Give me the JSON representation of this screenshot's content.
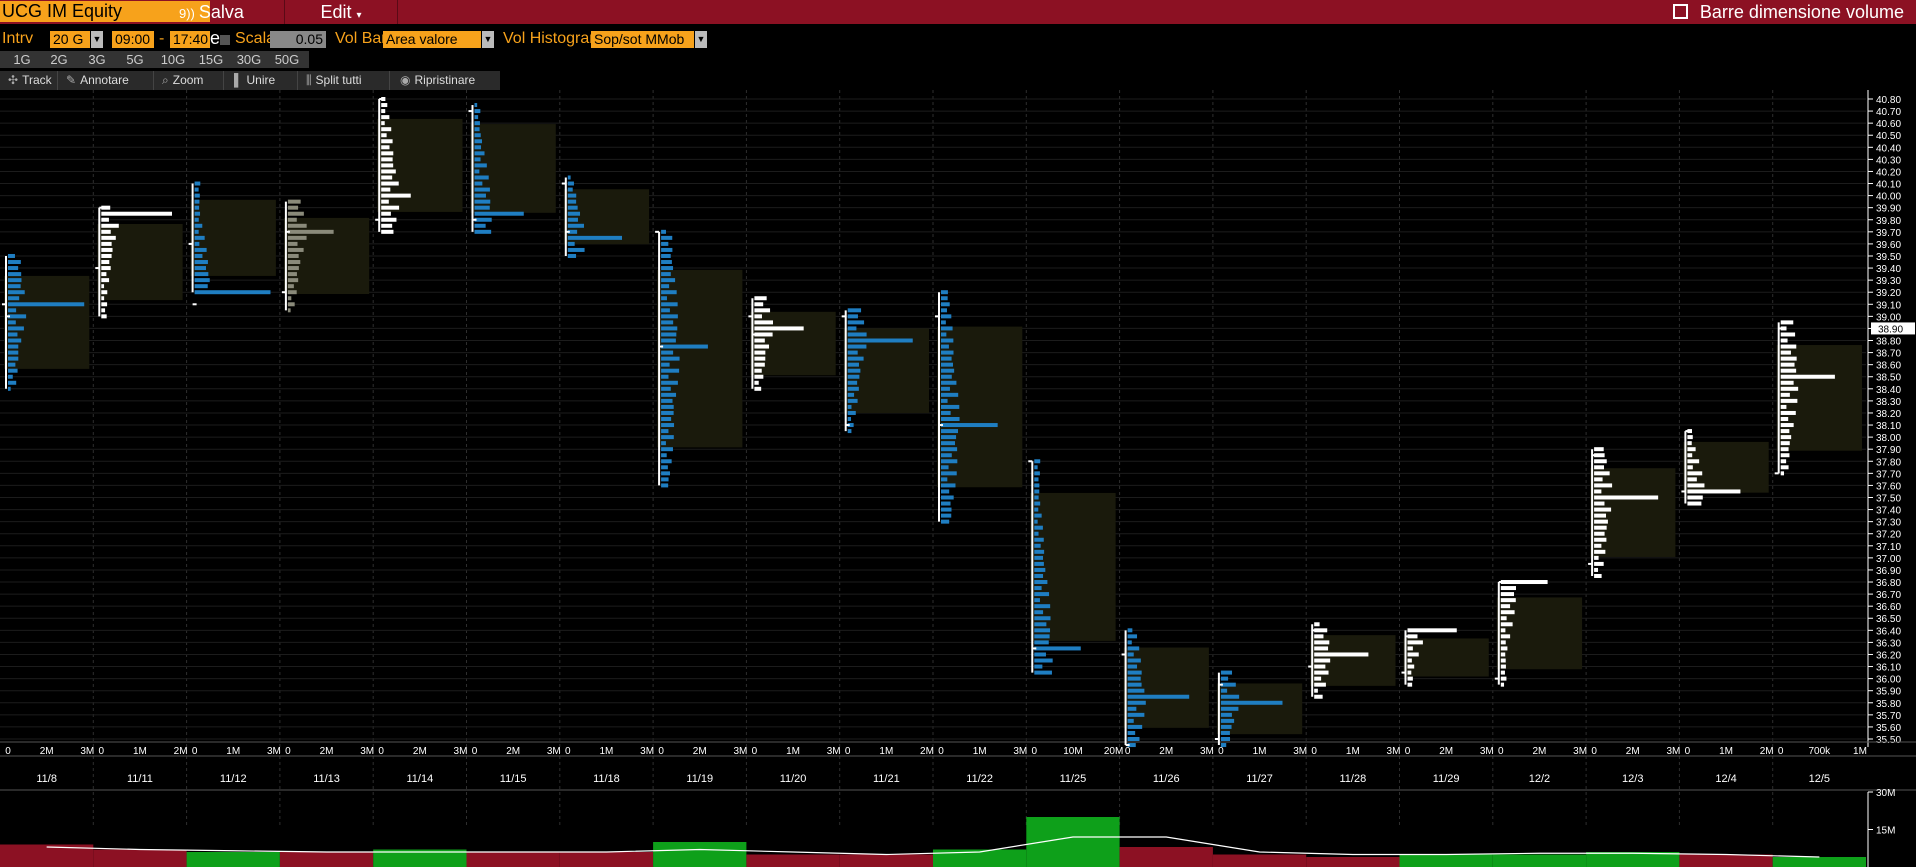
{
  "toolbar": {
    "ticker": "UCG IM Equity",
    "save_label": "Salva come",
    "edit_label": "Edit",
    "right_label": "Barre dimensione volume"
  },
  "settings": {
    "intrv_label": "Intrv",
    "intrv_value": "20 G",
    "start_time": "09:00",
    "dash": "-",
    "end_time": "17:40",
    "scala_label": "Scala",
    "scala_value": "0.05",
    "volbar_label": "Vol Bar",
    "volbar_value": "Area valore",
    "volhist_label": "Vol Histogram",
    "volhist_value": "Sop/sot MMob"
  },
  "periods": [
    "1G",
    "2G",
    "3G",
    "5G",
    "10G",
    "15G",
    "30G",
    "50G"
  ],
  "tools": [
    "Track",
    "Annotare",
    "Zoom",
    "Unire",
    "Split tutti",
    "Ripristinare"
  ],
  "chart_data": {
    "type": "bar",
    "title": "",
    "price_axis": {
      "ticks": [
        "40.80",
        "40.70",
        "40.60",
        "40.50",
        "40.40",
        "40.30",
        "40.20",
        "40.10",
        "40.00",
        "39.90",
        "39.80",
        "39.70",
        "39.60",
        "39.50",
        "39.40",
        "39.30",
        "39.20",
        "39.10",
        "39.00",
        "38.90",
        "38.80",
        "38.70",
        "38.60",
        "38.50",
        "38.40",
        "38.30",
        "38.20",
        "38.10",
        "38.00",
        "37.90",
        "37.80",
        "37.70",
        "37.60",
        "37.50",
        "37.40",
        "37.30",
        "37.20",
        "37.10",
        "37.00",
        "36.90",
        "36.80",
        "36.70",
        "36.60",
        "36.50",
        "36.40",
        "36.30",
        "36.20",
        "36.10",
        "36.00",
        "35.90",
        "35.80",
        "35.70",
        "35.60",
        "35.50"
      ],
      "ylim": [
        35.5,
        40.8
      ],
      "last_price": "38.90"
    },
    "days": [
      {
        "date": "11/8",
        "ticks": [
          "0",
          "2M",
          "3M"
        ],
        "max": 3.2,
        "low": 39.5,
        "high": 38.4,
        "open": 39.1,
        "close": 39.0,
        "color": "blue",
        "peak": [
          39.1,
          3.0
        ]
      },
      {
        "date": "11/11",
        "ticks": [
          "0",
          "1M",
          "2M"
        ],
        "max": 2.3,
        "low": 39.0,
        "high": 39.9,
        "open": 39.4,
        "close": 39.9,
        "color": "white",
        "peak": [
          39.85,
          2.0
        ]
      },
      {
        "date": "11/12",
        "ticks": [
          "0",
          "1M",
          "3M"
        ],
        "max": 3.0,
        "low": 39.2,
        "high": 40.1,
        "open": 39.6,
        "close": 39.1,
        "color": "blue",
        "peak": [
          39.2,
          2.8
        ]
      },
      {
        "date": "11/13",
        "ticks": [
          "0",
          "2M",
          "3M"
        ],
        "max": 3.2,
        "low": 39.05,
        "high": 39.95,
        "open": 39.2,
        "close": 39.7,
        "color": "gray",
        "peak": [
          39.7,
          1.8
        ]
      },
      {
        "date": "11/14",
        "ticks": [
          "0",
          "2M",
          "3M"
        ],
        "max": 3.3,
        "low": 39.7,
        "high": 40.8,
        "open": 39.8,
        "close": 40.8,
        "color": "white",
        "peak": [
          40.0,
          1.2
        ]
      },
      {
        "date": "11/15",
        "ticks": [
          "0",
          "2M",
          "3M"
        ],
        "max": 3.3,
        "low": 39.7,
        "high": 40.75,
        "open": 40.7,
        "close": 39.8,
        "color": "blue",
        "peak": [
          39.85,
          2.0
        ]
      },
      {
        "date": "11/18",
        "ticks": [
          "0",
          "1M",
          "3M"
        ],
        "max": 3.3,
        "low": 39.5,
        "high": 40.15,
        "open": 40.1,
        "close": 39.7,
        "color": "blue",
        "peak": [
          39.65,
          2.2
        ]
      },
      {
        "date": "11/19",
        "ticks": [
          "0",
          "2M",
          "3M"
        ],
        "max": 3.3,
        "low": 37.6,
        "high": 39.7,
        "open": 39.7,
        "close": 38.75,
        "color": "blue",
        "peak": [
          38.75,
          1.9
        ]
      },
      {
        "date": "11/20",
        "ticks": [
          "0",
          "1M",
          "3M"
        ],
        "max": 3.3,
        "low": 38.4,
        "high": 39.15,
        "open": 39.0,
        "close": 38.85,
        "color": "white",
        "peak": [
          38.9,
          2.0
        ]
      },
      {
        "date": "11/21",
        "ticks": [
          "0",
          "1M",
          "2M"
        ],
        "max": 2.5,
        "low": 38.05,
        "high": 39.05,
        "open": 39.0,
        "close": 38.1,
        "color": "blue",
        "peak": [
          38.8,
          2.0
        ]
      },
      {
        "date": "11/22",
        "ticks": [
          "0",
          "1M",
          "3M"
        ],
        "max": 3.3,
        "low": 37.3,
        "high": 39.2,
        "open": 39.0,
        "close": 38.1,
        "color": "blue",
        "peak": [
          38.1,
          2.3
        ]
      },
      {
        "date": "11/25",
        "ticks": [
          "0",
          "10M",
          "20M"
        ],
        "max": 21.0,
        "low": 36.05,
        "high": 37.8,
        "open": 37.8,
        "close": 36.25,
        "color": "blue",
        "peak": [
          36.25,
          12.0
        ]
      },
      {
        "date": "11/26",
        "ticks": [
          "0",
          "2M",
          "3M"
        ],
        "max": 3.3,
        "low": 35.45,
        "high": 36.4,
        "open": 36.2,
        "close": 35.45,
        "color": "blue",
        "peak": [
          35.85,
          2.5
        ]
      },
      {
        "date": "11/27",
        "ticks": [
          "0",
          "1M",
          "3M"
        ],
        "max": 3.3,
        "low": 35.45,
        "high": 36.05,
        "open": 35.5,
        "close": 35.95,
        "color": "blue",
        "peak": [
          35.8,
          2.5
        ]
      },
      {
        "date": "11/28",
        "ticks": [
          "0",
          "1M",
          "3M"
        ],
        "max": 3.3,
        "low": 35.85,
        "high": 36.45,
        "open": 36.1,
        "close": 36.4,
        "color": "white",
        "peak": [
          36.2,
          2.2
        ]
      },
      {
        "date": "11/29",
        "ticks": [
          "0",
          "2M",
          "3M"
        ],
        "max": 3.3,
        "low": 35.95,
        "high": 36.4,
        "open": 36.05,
        "close": 36.35,
        "color": "white",
        "peak": [
          36.4,
          2.0
        ]
      },
      {
        "date": "12/2",
        "ticks": [
          "0",
          "2M",
          "3M"
        ],
        "max": 3.3,
        "low": 35.95,
        "high": 36.8,
        "open": 36.0,
        "close": 36.8,
        "color": "white",
        "peak": [
          36.8,
          1.9
        ]
      },
      {
        "date": "12/3",
        "ticks": [
          "0",
          "2M",
          "3M"
        ],
        "max": 3.3,
        "low": 36.85,
        "high": 37.9,
        "open": 36.95,
        "close": 37.85,
        "color": "white",
        "peak": [
          37.5,
          2.6
        ]
      },
      {
        "date": "12/4",
        "ticks": [
          "0",
          "1M",
          "2M"
        ],
        "max": 2.3,
        "low": 37.45,
        "high": 38.05,
        "open": 37.55,
        "close": 38.05,
        "color": "white",
        "peak": [
          37.55,
          1.5
        ]
      },
      {
        "date": "12/5",
        "ticks": [
          "0",
          "700k",
          "1M"
        ],
        "max": 1.2,
        "low": 37.7,
        "high": 38.95,
        "open": 37.7,
        "close": 38.9,
        "color": "white",
        "peak": [
          38.5,
          0.8
        ]
      }
    ],
    "volume": {
      "ticks": [
        "30M",
        "15M"
      ],
      "ymax": 30,
      "bars": [
        9,
        7,
        6,
        6,
        7,
        6,
        6,
        10,
        5,
        5,
        7,
        20,
        8,
        5,
        4,
        5,
        5,
        6,
        5,
        4
      ],
      "bar_colors": [
        "red",
        "red",
        "green",
        "red",
        "green",
        "red",
        "red",
        "green",
        "red",
        "red",
        "green",
        "green",
        "red",
        "red",
        "red",
        "green",
        "green",
        "green",
        "red",
        "green"
      ],
      "avg_line": [
        8,
        7,
        6.5,
        6,
        6,
        6,
        6,
        7,
        6,
        5,
        6,
        12,
        12,
        6,
        5,
        5,
        5.5,
        5.5,
        5,
        4
      ]
    }
  }
}
